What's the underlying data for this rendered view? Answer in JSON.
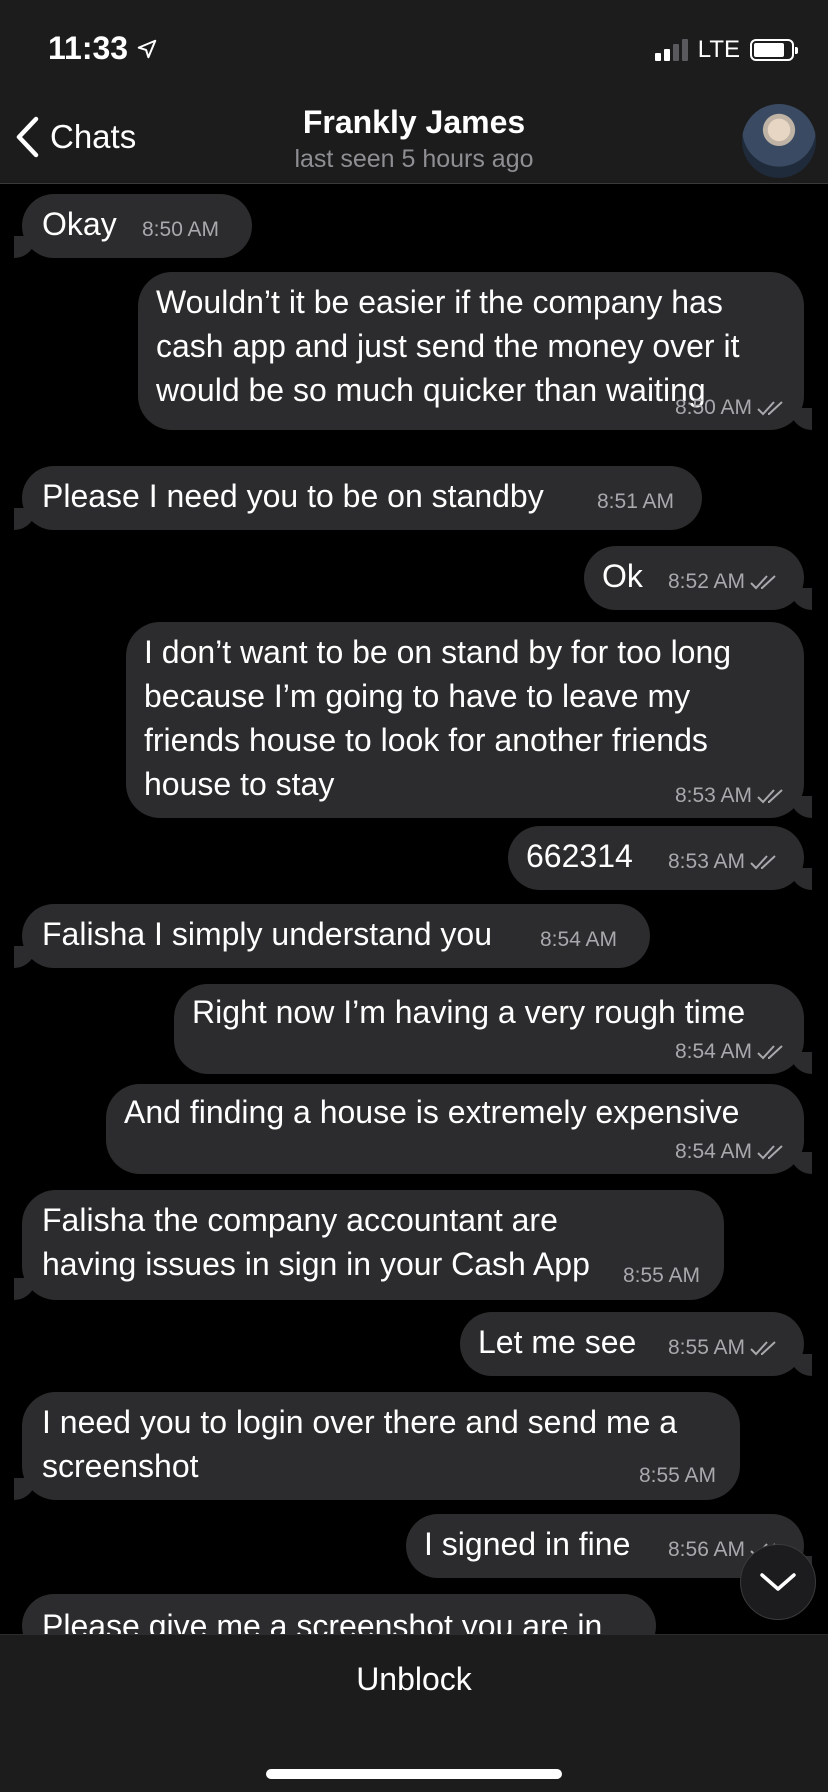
{
  "status_bar": {
    "time": "11:33",
    "network": "LTE",
    "battery_fraction": 0.8,
    "signal_bars": 2
  },
  "nav": {
    "back_label": "Chats",
    "contact_name": "Frankly James",
    "last_seen": "last seen 5 hours ago"
  },
  "messages": [
    {
      "direction": "in",
      "text": "Okay",
      "time": "8:50 AM"
    },
    {
      "direction": "out",
      "text": "Wouldn’t it be easier if the company has cash app and just send the money over it would be so much quicker than waiting",
      "time": "8:50 AM",
      "read": true
    },
    {
      "direction": "in",
      "text": "Please I need you to be on standby",
      "time": "8:51 AM"
    },
    {
      "direction": "out",
      "text": "Ok",
      "time": "8:52 AM",
      "read": true
    },
    {
      "direction": "out",
      "text": "I don’t want to be on stand by for too long because I’m going to have to leave my friends house to look for another friends house to stay",
      "time": "8:53 AM",
      "read": true
    },
    {
      "direction": "out",
      "text": "662314",
      "time": "8:53 AM",
      "read": true
    },
    {
      "direction": "in",
      "text": "Falisha I simply understand you",
      "time": "8:54 AM"
    },
    {
      "direction": "out",
      "text": "Right now I’m having a very rough time",
      "time": "8:54 AM",
      "read": true
    },
    {
      "direction": "out",
      "text": "And finding a house is extremely expensive",
      "time": "8:54 AM",
      "read": true
    },
    {
      "direction": "in",
      "text": "Falisha the company accountant are having issues in sign in your Cash App",
      "time": "8:55 AM"
    },
    {
      "direction": "out",
      "text": "Let me see",
      "time": "8:55 AM",
      "read": true
    },
    {
      "direction": "in",
      "text": "I need you to login over there and send me a screenshot",
      "time": "8:55 AM"
    },
    {
      "direction": "out",
      "text": "I signed in fine",
      "time": "8:56 AM",
      "read": true
    },
    {
      "direction": "in",
      "text": "Please give me a screenshot you are in",
      "time": ""
    }
  ],
  "footer": {
    "unblock_label": "Unblock"
  },
  "icons": {
    "location": "location-arrow-icon",
    "back": "chevron-left-icon",
    "read_receipt": "double-check-icon",
    "scroll_down": "chevron-down-icon"
  }
}
